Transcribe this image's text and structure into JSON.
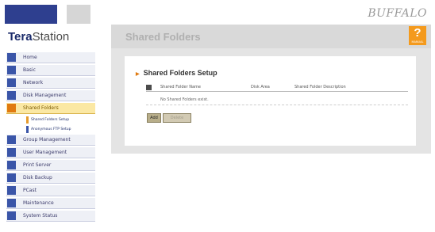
{
  "app": {
    "logo_bold": "Tera",
    "logo_rest": "Station",
    "brand": "BUFFALO"
  },
  "header": {
    "title": "Shared Folders",
    "help_symbol": "?",
    "help_label": "MANUAL"
  },
  "sidebar": {
    "items": [
      {
        "label": "Home",
        "icon": "home-icon"
      },
      {
        "label": "Basic",
        "icon": "basic-icon"
      },
      {
        "label": "Network",
        "icon": "network-icon"
      },
      {
        "label": "Disk Management",
        "icon": "disk-icon"
      },
      {
        "label": "Shared Folders",
        "icon": "folder-icon",
        "active": true
      },
      {
        "label": "Group Management",
        "icon": "group-icon"
      },
      {
        "label": "User Management",
        "icon": "user-icon"
      },
      {
        "label": "Print Server",
        "icon": "printer-icon"
      },
      {
        "label": "Disk Backup",
        "icon": "backup-icon"
      },
      {
        "label": "PCast",
        "icon": "pcast-icon"
      },
      {
        "label": "Maintenance",
        "icon": "maintenance-icon"
      },
      {
        "label": "System Status",
        "icon": "status-icon"
      }
    ],
    "subitems": [
      {
        "label": "Shared Folders Setup"
      },
      {
        "label": "Anonymous FTP Setup"
      }
    ]
  },
  "main": {
    "section_title": "Shared Folders Setup",
    "columns": [
      "Shared Folder Name",
      "Disk Area",
      "Shared Folder Description"
    ],
    "empty_message": "No Shared Folders exist.",
    "buttons": {
      "add": "Add",
      "delete": "Delete"
    }
  },
  "colors": {
    "accent": "#f49a1d",
    "brand_blue": "#2e3f8f",
    "active_nav": "#fbe8a4"
  }
}
